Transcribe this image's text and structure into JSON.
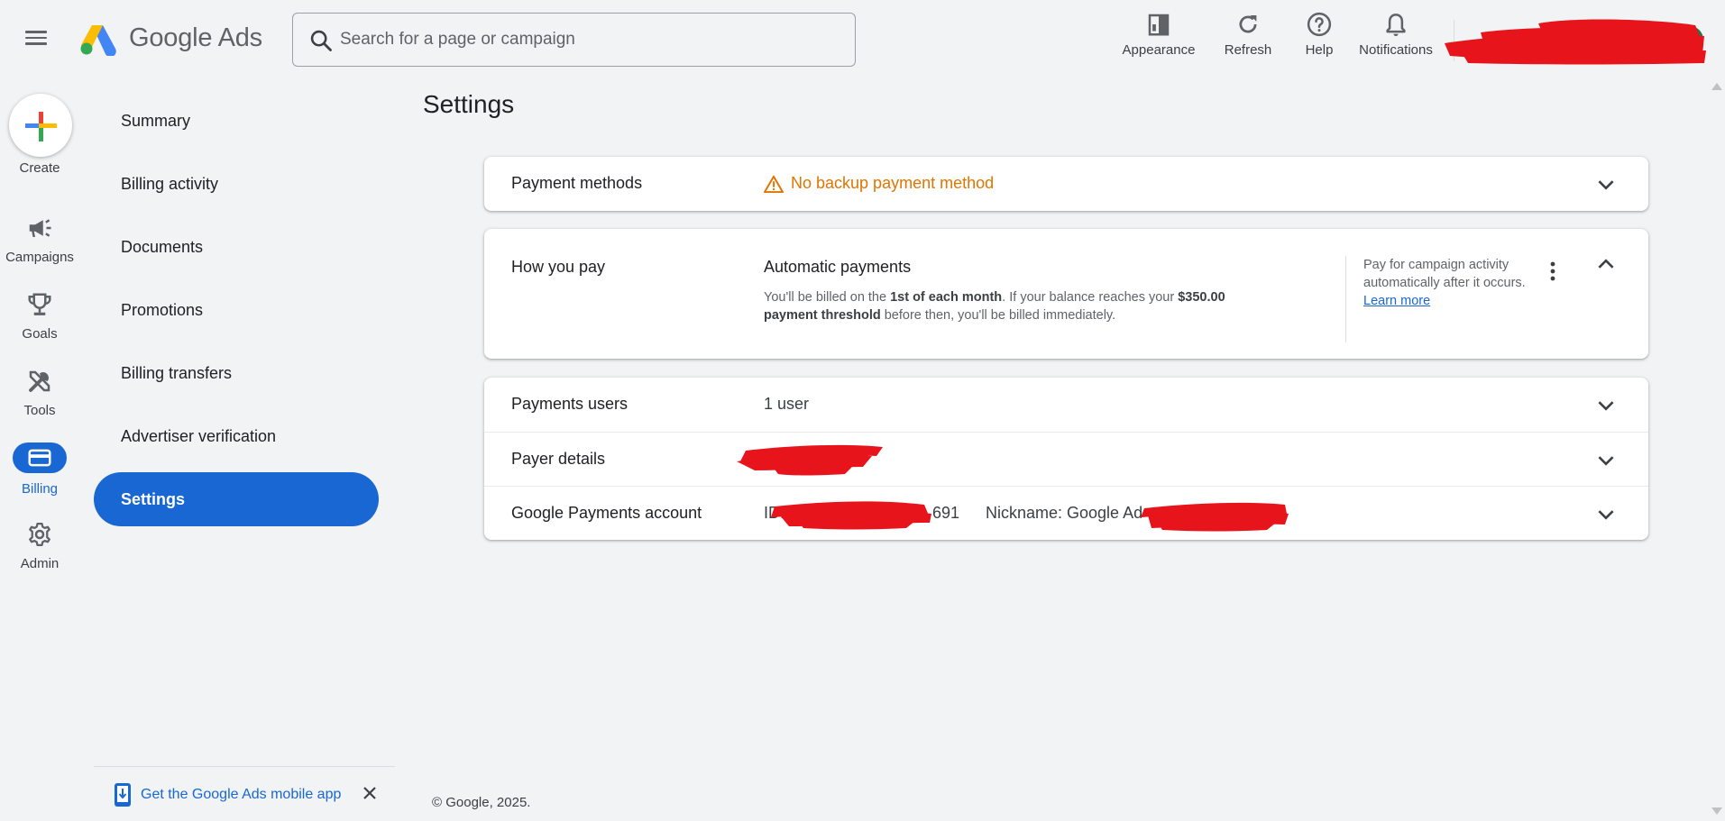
{
  "header": {
    "brand": "Google Ads",
    "search_placeholder": "Search for a page or campaign",
    "actions": [
      {
        "label": "Appearance",
        "icon": "appearance-icon"
      },
      {
        "label": "Refresh",
        "icon": "refresh-icon"
      },
      {
        "label": "Help",
        "icon": "help-icon"
      },
      {
        "label": "Notifications",
        "icon": "bell-icon"
      }
    ]
  },
  "rail": {
    "create": "Create",
    "items": [
      {
        "label": "Campaigns",
        "icon": "megaphone-icon"
      },
      {
        "label": "Goals",
        "icon": "trophy-icon"
      },
      {
        "label": "Tools",
        "icon": "tools-icon"
      },
      {
        "label": "Billing",
        "icon": "credit-card-icon",
        "active": true
      },
      {
        "label": "Admin",
        "icon": "gear-icon"
      }
    ]
  },
  "subnav": {
    "items": [
      {
        "label": "Summary"
      },
      {
        "label": "Billing activity"
      },
      {
        "label": "Documents"
      },
      {
        "label": "Promotions"
      },
      {
        "label": "Billing transfers"
      },
      {
        "label": "Advertiser verification"
      },
      {
        "label": "Settings",
        "active": true
      }
    ],
    "promo": "Get the Google Ads mobile app"
  },
  "main": {
    "title": "Settings",
    "payment_methods": {
      "label": "Payment methods",
      "warning": "No backup payment method"
    },
    "how_you_pay": {
      "label": "How you pay",
      "title": "Automatic payments",
      "desc_1": "You'll be billed on the ",
      "desc_bold_1": "1st of each month",
      "desc_2": ". If your balance reaches your ",
      "desc_bold_2": "$350.00 payment threshold",
      "desc_3": " before then, you'll be billed immediately.",
      "side_text": "Pay for campaign activity automatically after it occurs.",
      "side_link": "Learn more"
    },
    "payments_users": {
      "label": "Payments users",
      "value": "1 user"
    },
    "payer_details": {
      "label": "Payer details"
    },
    "payments_account": {
      "label": "Google Payments account",
      "id_prefix": "ID:",
      "id_suffix": "691",
      "nickname_prefix": "Nickname: Google Ad"
    }
  },
  "footer": "© Google, 2025.",
  "colors": {
    "accent": "#1967d2",
    "warning": "#e37400",
    "redaction": "#e8141c"
  }
}
